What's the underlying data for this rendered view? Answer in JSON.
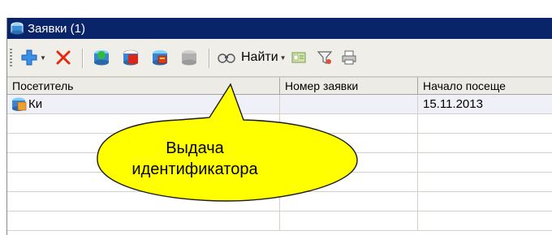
{
  "window": {
    "title": "Заявки (1)"
  },
  "toolbar": {
    "items": [
      {
        "name": "add-icon",
        "has_dropdown": true
      },
      {
        "name": "delete-icon",
        "has_dropdown": false
      },
      {
        "name": "request-green-icon"
      },
      {
        "name": "request-red-icon"
      },
      {
        "name": "request-issue-id-icon"
      },
      {
        "name": "request-disabled-icon"
      },
      {
        "name": "find-icon",
        "label": "Найти",
        "has_dropdown": true
      },
      {
        "name": "card-icon"
      },
      {
        "name": "filter-icon"
      },
      {
        "name": "print-icon"
      }
    ],
    "find_label": "Найти"
  },
  "grid": {
    "columns": [
      "Посетитель",
      "Номер заявки",
      "Начало посеще"
    ],
    "rows": [
      {
        "visitor": "Ки",
        "number": "",
        "start": "15.11.2013"
      }
    ]
  },
  "callout": {
    "line1": "Выдача",
    "line2": "идентификатора"
  },
  "colors": {
    "title_bar": "#0a246a",
    "callout_fill": "#ffff00",
    "delete_red": "#e52a10",
    "add_blue": "#3a8fe8"
  }
}
